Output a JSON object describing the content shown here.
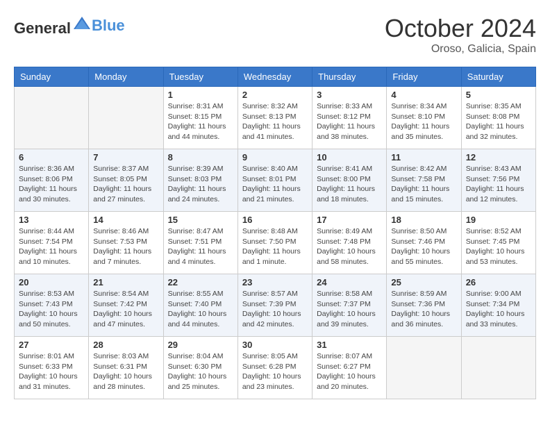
{
  "header": {
    "logo_general": "General",
    "logo_blue": "Blue",
    "month_title": "October 2024",
    "location": "Oroso, Galicia, Spain"
  },
  "weekdays": [
    "Sunday",
    "Monday",
    "Tuesday",
    "Wednesday",
    "Thursday",
    "Friday",
    "Saturday"
  ],
  "weeks": [
    [
      {
        "day": "",
        "info": ""
      },
      {
        "day": "",
        "info": ""
      },
      {
        "day": "1",
        "info": "Sunrise: 8:31 AM\nSunset: 8:15 PM\nDaylight: 11 hours and 44 minutes."
      },
      {
        "day": "2",
        "info": "Sunrise: 8:32 AM\nSunset: 8:13 PM\nDaylight: 11 hours and 41 minutes."
      },
      {
        "day": "3",
        "info": "Sunrise: 8:33 AM\nSunset: 8:12 PM\nDaylight: 11 hours and 38 minutes."
      },
      {
        "day": "4",
        "info": "Sunrise: 8:34 AM\nSunset: 8:10 PM\nDaylight: 11 hours and 35 minutes."
      },
      {
        "day": "5",
        "info": "Sunrise: 8:35 AM\nSunset: 8:08 PM\nDaylight: 11 hours and 32 minutes."
      }
    ],
    [
      {
        "day": "6",
        "info": "Sunrise: 8:36 AM\nSunset: 8:06 PM\nDaylight: 11 hours and 30 minutes."
      },
      {
        "day": "7",
        "info": "Sunrise: 8:37 AM\nSunset: 8:05 PM\nDaylight: 11 hours and 27 minutes."
      },
      {
        "day": "8",
        "info": "Sunrise: 8:39 AM\nSunset: 8:03 PM\nDaylight: 11 hours and 24 minutes."
      },
      {
        "day": "9",
        "info": "Sunrise: 8:40 AM\nSunset: 8:01 PM\nDaylight: 11 hours and 21 minutes."
      },
      {
        "day": "10",
        "info": "Sunrise: 8:41 AM\nSunset: 8:00 PM\nDaylight: 11 hours and 18 minutes."
      },
      {
        "day": "11",
        "info": "Sunrise: 8:42 AM\nSunset: 7:58 PM\nDaylight: 11 hours and 15 minutes."
      },
      {
        "day": "12",
        "info": "Sunrise: 8:43 AM\nSunset: 7:56 PM\nDaylight: 11 hours and 12 minutes."
      }
    ],
    [
      {
        "day": "13",
        "info": "Sunrise: 8:44 AM\nSunset: 7:54 PM\nDaylight: 11 hours and 10 minutes."
      },
      {
        "day": "14",
        "info": "Sunrise: 8:46 AM\nSunset: 7:53 PM\nDaylight: 11 hours and 7 minutes."
      },
      {
        "day": "15",
        "info": "Sunrise: 8:47 AM\nSunset: 7:51 PM\nDaylight: 11 hours and 4 minutes."
      },
      {
        "day": "16",
        "info": "Sunrise: 8:48 AM\nSunset: 7:50 PM\nDaylight: 11 hours and 1 minute."
      },
      {
        "day": "17",
        "info": "Sunrise: 8:49 AM\nSunset: 7:48 PM\nDaylight: 10 hours and 58 minutes."
      },
      {
        "day": "18",
        "info": "Sunrise: 8:50 AM\nSunset: 7:46 PM\nDaylight: 10 hours and 55 minutes."
      },
      {
        "day": "19",
        "info": "Sunrise: 8:52 AM\nSunset: 7:45 PM\nDaylight: 10 hours and 53 minutes."
      }
    ],
    [
      {
        "day": "20",
        "info": "Sunrise: 8:53 AM\nSunset: 7:43 PM\nDaylight: 10 hours and 50 minutes."
      },
      {
        "day": "21",
        "info": "Sunrise: 8:54 AM\nSunset: 7:42 PM\nDaylight: 10 hours and 47 minutes."
      },
      {
        "day": "22",
        "info": "Sunrise: 8:55 AM\nSunset: 7:40 PM\nDaylight: 10 hours and 44 minutes."
      },
      {
        "day": "23",
        "info": "Sunrise: 8:57 AM\nSunset: 7:39 PM\nDaylight: 10 hours and 42 minutes."
      },
      {
        "day": "24",
        "info": "Sunrise: 8:58 AM\nSunset: 7:37 PM\nDaylight: 10 hours and 39 minutes."
      },
      {
        "day": "25",
        "info": "Sunrise: 8:59 AM\nSunset: 7:36 PM\nDaylight: 10 hours and 36 minutes."
      },
      {
        "day": "26",
        "info": "Sunrise: 9:00 AM\nSunset: 7:34 PM\nDaylight: 10 hours and 33 minutes."
      }
    ],
    [
      {
        "day": "27",
        "info": "Sunrise: 8:01 AM\nSunset: 6:33 PM\nDaylight: 10 hours and 31 minutes."
      },
      {
        "day": "28",
        "info": "Sunrise: 8:03 AM\nSunset: 6:31 PM\nDaylight: 10 hours and 28 minutes."
      },
      {
        "day": "29",
        "info": "Sunrise: 8:04 AM\nSunset: 6:30 PM\nDaylight: 10 hours and 25 minutes."
      },
      {
        "day": "30",
        "info": "Sunrise: 8:05 AM\nSunset: 6:28 PM\nDaylight: 10 hours and 23 minutes."
      },
      {
        "day": "31",
        "info": "Sunrise: 8:07 AM\nSunset: 6:27 PM\nDaylight: 10 hours and 20 minutes."
      },
      {
        "day": "",
        "info": ""
      },
      {
        "day": "",
        "info": ""
      }
    ]
  ]
}
